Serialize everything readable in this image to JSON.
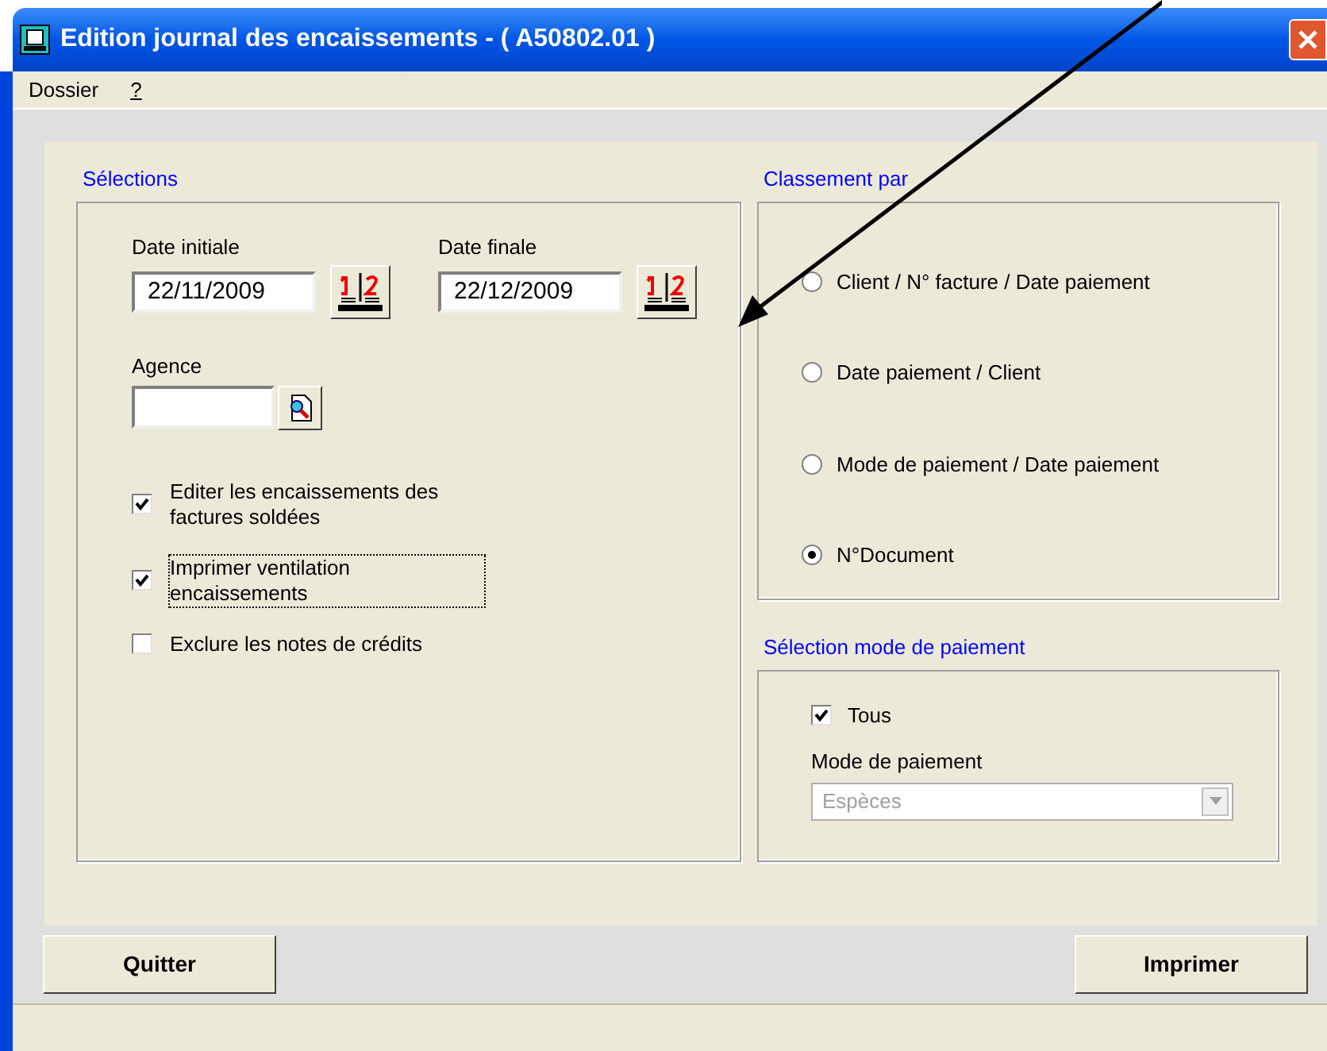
{
  "window": {
    "title": "Edition journal des encaissements - ( A50802.01 )"
  },
  "menu": [
    {
      "label": "Dossier",
      "underlined": false
    },
    {
      "label": "?",
      "underlined": true
    }
  ],
  "selections": {
    "title": "Sélections",
    "date_initiale": {
      "label": "Date initiale",
      "value": "22/11/2009"
    },
    "date_finale": {
      "label": "Date finale",
      "value": "22/12/2009"
    },
    "agence": {
      "label": "Agence"
    },
    "options": [
      {
        "label": "Editer les encaissements des factures soldées",
        "checked": true,
        "focused": false
      },
      {
        "label": "Imprimer ventilation encaissements",
        "checked": true,
        "focused": true
      },
      {
        "label": "Exclure les notes de crédits",
        "checked": false,
        "focused": false
      }
    ]
  },
  "classement": {
    "title": "Classement par",
    "options": [
      {
        "label": "Client / N° facture / Date paiement",
        "selected": false
      },
      {
        "label": "Date paiement / Client",
        "selected": false
      },
      {
        "label": "Mode de paiement / Date paiement",
        "selected": false
      },
      {
        "label": "N°Document",
        "selected": true
      }
    ]
  },
  "mode_paiement": {
    "title": "Sélection mode de paiement",
    "tous": {
      "label": "Tous",
      "checked": true
    },
    "field_label": "Mode de paiement",
    "value": "Espèces",
    "disabled": true
  },
  "buttons": [
    "Quitter",
    "Imprimer"
  ]
}
